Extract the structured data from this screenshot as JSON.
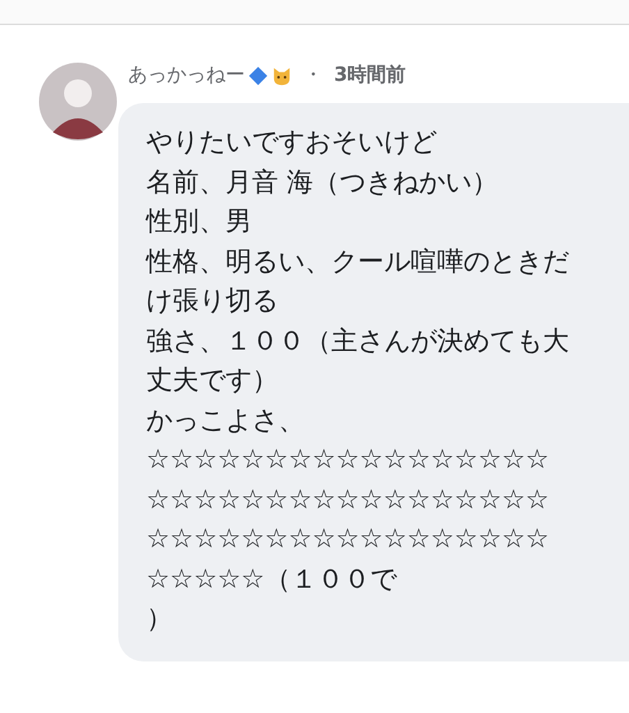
{
  "comment": {
    "author": "あっかっねー",
    "separator": "・",
    "time": "3時間前",
    "lines": [
      "やりたいですおそいけど",
      "名前、月音 海（つきねかい）",
      "性別、男",
      "性格、明るい、クール喧嘩のときだ",
      "け張り切る",
      "強さ、１００（主さんが決めても大",
      "丈夫です）",
      "かっこよさ、",
      "☆☆☆☆☆☆☆☆☆☆☆☆☆☆☆☆☆",
      "☆☆☆☆☆☆☆☆☆☆☆☆☆☆☆☆☆",
      "☆☆☆☆☆☆☆☆☆☆☆☆☆☆☆☆☆",
      "☆☆☆☆☆（１００で",
      "）"
    ]
  }
}
